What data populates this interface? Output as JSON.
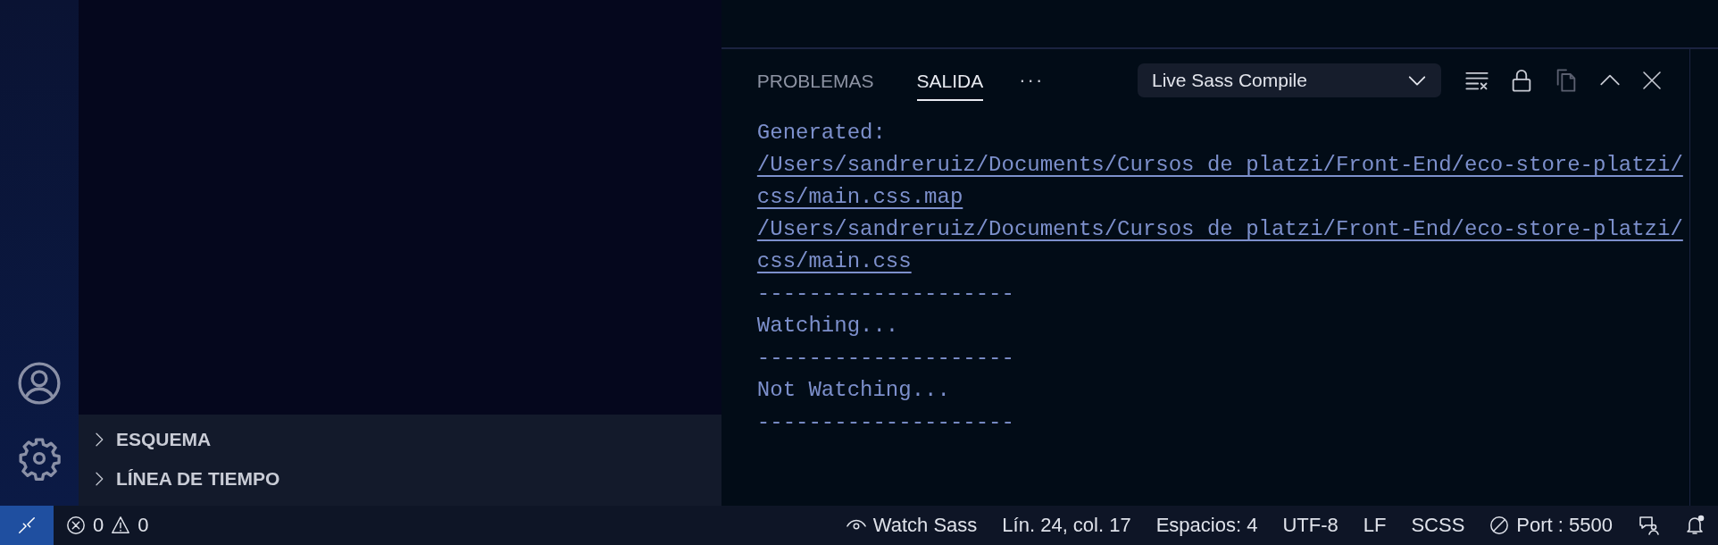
{
  "sidebar": {
    "sections": [
      {
        "label": "ESQUEMA",
        "expanded": false
      },
      {
        "label": "LÍNEA DE TIEMPO",
        "expanded": false
      }
    ]
  },
  "panel": {
    "tabs": [
      {
        "label": "PROBLEMAS",
        "selected": false
      },
      {
        "label": "SALIDA",
        "selected": true
      }
    ],
    "more": "···",
    "channel": "Live Sass Compile",
    "lines": [
      {
        "kind": "text",
        "text": "Generated:"
      },
      {
        "kind": "link",
        "text": "/Users/sandreruiz/Documents/Cursos de platzi/Front-End/eco-store-platzi/css/main.css.map"
      },
      {
        "kind": "link",
        "text": "/Users/sandreruiz/Documents/Cursos de platzi/Front-End/eco-store-platzi/css/main.css"
      },
      {
        "kind": "text",
        "text": "--------------------"
      },
      {
        "kind": "text",
        "text": "Watching..."
      },
      {
        "kind": "text",
        "text": "--------------------"
      },
      {
        "kind": "text",
        "text": "Not Watching..."
      },
      {
        "kind": "text",
        "text": "--------------------"
      }
    ]
  },
  "status_bar": {
    "errors": "0",
    "warnings": "0",
    "items": [
      {
        "kind": "eye",
        "text": "Watch Sass"
      },
      {
        "kind": "plain",
        "text": "Lín. 24, col. 17"
      },
      {
        "kind": "plain",
        "text": "Espacios: 4"
      },
      {
        "kind": "plain",
        "text": "UTF-8"
      },
      {
        "kind": "plain",
        "text": "LF"
      },
      {
        "kind": "plain",
        "text": "SCSS"
      },
      {
        "kind": "ban",
        "text": "Port : 5500"
      }
    ]
  }
}
